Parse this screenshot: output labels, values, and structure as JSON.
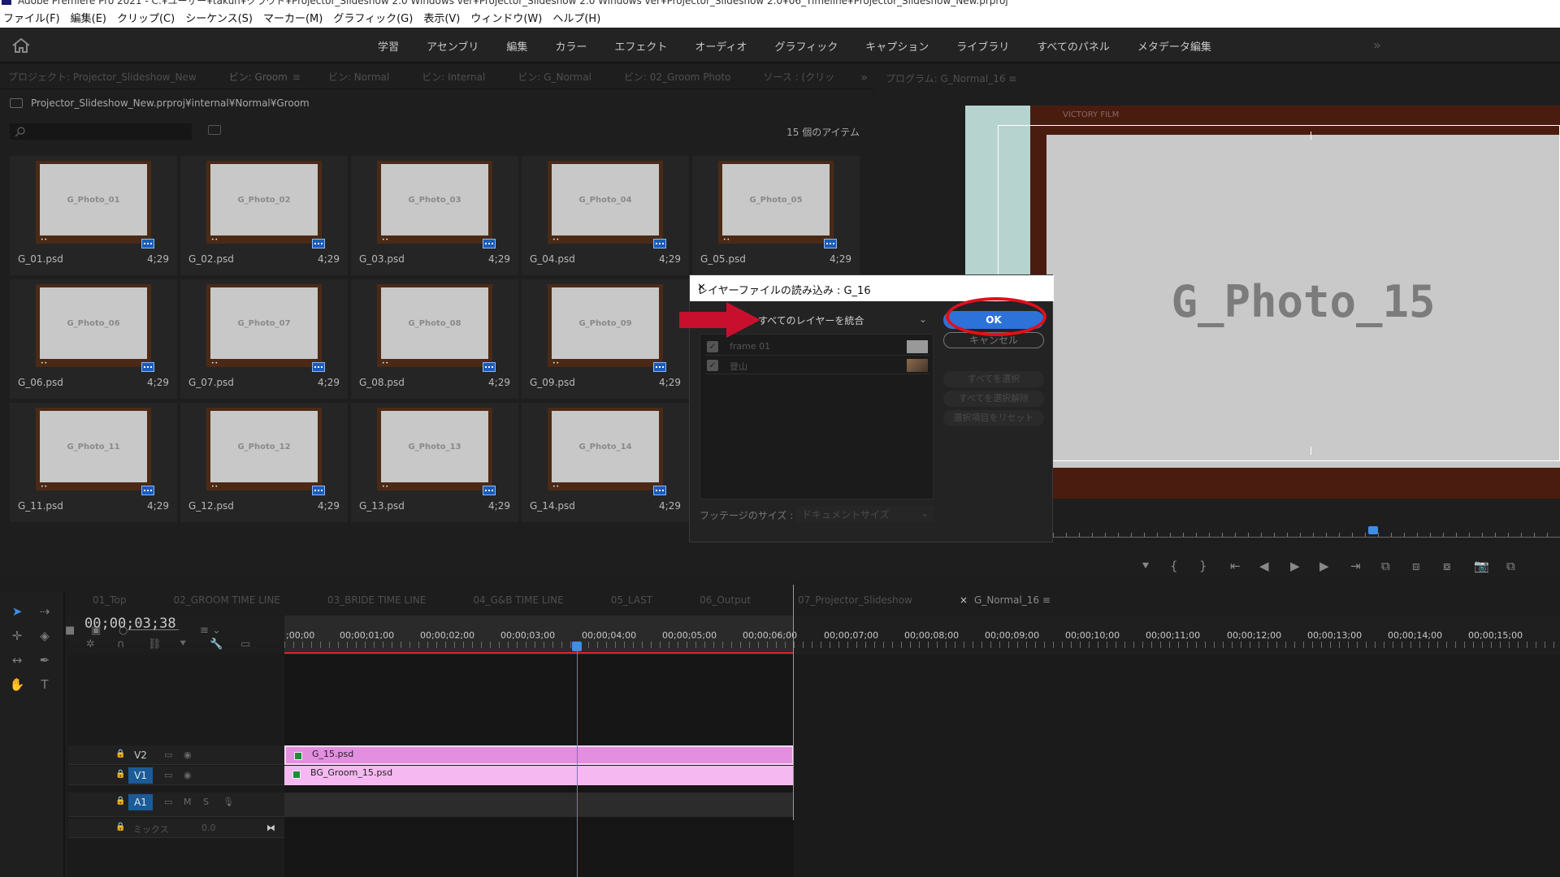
{
  "window": {
    "title": "Adobe Premiere Pro 2021 - C:¥ユーザー¥takuh¥クラウド¥Projector_Slideshow 2.0 Windows ver¥Projector_Slideshow 2.0 Windows ver¥Projector_Slideshow 2.0¥06_Timeline¥Projector_Slideshow_New.prproj"
  },
  "menu": [
    "ファイル(F)",
    "編集(E)",
    "クリップ(C)",
    "シーケンス(S)",
    "マーカー(M)",
    "グラフィック(G)",
    "表示(V)",
    "ウィンドウ(W)",
    "ヘルプ(H)"
  ],
  "workspaces": [
    "学習",
    "アセンブリ",
    "編集",
    "カラー",
    "エフェクト",
    "オーディオ",
    "グラフィック",
    "キャプション",
    "ライブラリ",
    "すべてのパネル",
    "メタデータ編集"
  ],
  "project_panel": {
    "tabs": [
      "プロジェクト: Projector_Slideshow_New",
      "ビン: Groom",
      "ビン: Normal",
      "ビン: Internal",
      "ビン: G_Normal",
      "ビン: 02_Groom Photo",
      "ソース : (クリッ"
    ],
    "path": "Projector_Slideshow_New.prproj¥internal¥Normal¥Groom",
    "item_count": "15 個のアイテム",
    "items": [
      {
        "thumb": "G_Photo_01",
        "file": "G_01.psd",
        "dur": "4;29"
      },
      {
        "thumb": "G_Photo_02",
        "file": "G_02.psd",
        "dur": "4;29"
      },
      {
        "thumb": "G_Photo_03",
        "file": "G_03.psd",
        "dur": "4;29"
      },
      {
        "thumb": "G_Photo_04",
        "file": "G_04.psd",
        "dur": "4;29"
      },
      {
        "thumb": "G_Photo_05",
        "file": "G_05.psd",
        "dur": "4;29"
      },
      {
        "thumb": "G_Photo_06",
        "file": "G_06.psd",
        "dur": "4;29"
      },
      {
        "thumb": "G_Photo_07",
        "file": "G_07.psd",
        "dur": "4;29"
      },
      {
        "thumb": "G_Photo_08",
        "file": "G_08.psd",
        "dur": "4;29"
      },
      {
        "thumb": "G_Photo_09",
        "file": "G_09.psd",
        "dur": "4;29"
      },
      {
        "thumb": "G_Photo_11",
        "file": "G_11.psd",
        "dur": "4;29"
      },
      {
        "thumb": "G_Photo_12",
        "file": "G_12.psd",
        "dur": "4;29"
      },
      {
        "thumb": "G_Photo_13",
        "file": "G_13.psd",
        "dur": "4;29"
      },
      {
        "thumb": "G_Photo_14",
        "file": "G_14.psd",
        "dur": "4;29"
      }
    ]
  },
  "program": {
    "tab": "プログラム: G_Normal_16",
    "photo_text": "G_Photo_15",
    "frame_label": "VICTORY FILM"
  },
  "dialog": {
    "title": "レイヤーファイルの読み込み : G_16",
    "mode": "すべてのレイヤーを統合",
    "ok": "OK",
    "cancel": "キャンセル",
    "select_all": "すべてを選択",
    "deselect_all": "すべてを選択解除",
    "reset": "選択項目をリセット",
    "layers": [
      "frame 01",
      "登山"
    ],
    "footage_label": "フッテージのサイズ :",
    "footage_value": "ドキュメントサイズ"
  },
  "timeline": {
    "tabs": [
      "01_Top",
      "02_GROOM TIME LINE",
      "03_BRIDE TIME LINE",
      "04_G&B TIME LINE",
      "05_LAST",
      "06_Output",
      "07_Projector_Slideshow",
      "G_Normal_16"
    ],
    "timecode": "00;00;03;38",
    "ticks": [
      ";00;00",
      "00;00;01;00",
      "00;00;02;00",
      "00;00;03;00",
      "00;00;04;00",
      "00;00;05;00",
      "00;00;06;00",
      "00;00;07;00",
      "00;00;08;00",
      "00;00;09;00",
      "00;00;10;00",
      "00;00;11;00",
      "00;00;12;00",
      "00;00;13;00",
      "00;00;14;00",
      "00;00;15;00"
    ],
    "tracks": {
      "v2": "V2",
      "v1": "V1",
      "a1": "A1",
      "mix": "ミックス",
      "mix_value": "0.0"
    },
    "clips": {
      "v2": "G_15.psd",
      "v1": "BG_Groom_15.psd"
    }
  },
  "colors": {
    "accent": "#2d72d9",
    "annotation": "#e0101c",
    "clip_v2": "#e48ee0",
    "clip_v1": "#f5b8f0"
  }
}
